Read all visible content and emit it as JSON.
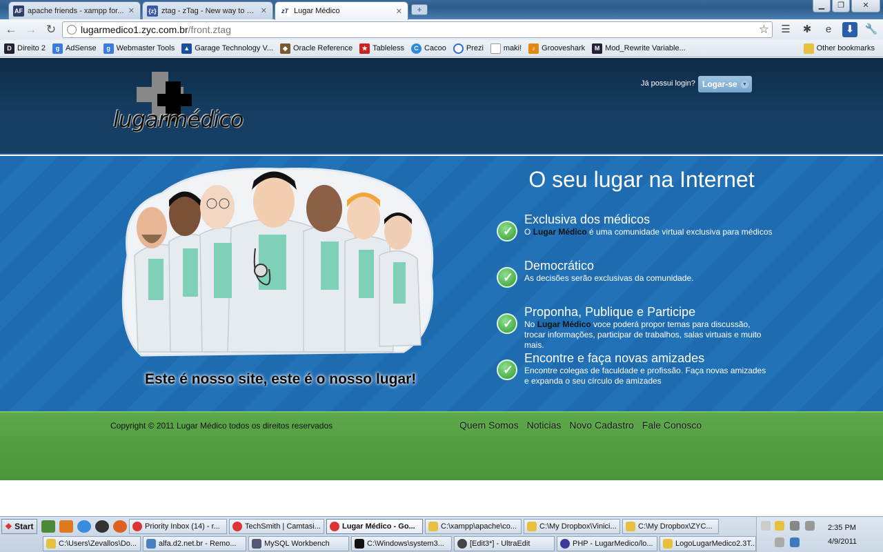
{
  "browser": {
    "tabs": [
      {
        "label": "apache friends - xampp for...",
        "icon": "AF",
        "icon_color": "#2a3d6a"
      },
      {
        "label": "ztag - zTag - New way to d...",
        "icon": "{z}",
        "icon_color": "#3a5aa5"
      },
      {
        "label": "Lugar Médico",
        "icon": "zT",
        "icon_color": "#0d3b70"
      }
    ],
    "url_host": "lugarmedico1.zyc.com.br",
    "url_path": "/front.ztag",
    "bookmarks": [
      {
        "label": "Direito 2",
        "color": "#223"
      },
      {
        "label": "AdSense",
        "color": "#3a7be0"
      },
      {
        "label": "Webmaster Tools",
        "color": "#3a7be0"
      },
      {
        "label": "Garage Technology V...",
        "color": "#1a4f9e"
      },
      {
        "label": "Oracle Reference",
        "color": "#7a5a30"
      },
      {
        "label": "Tableless",
        "color": "#cc2222"
      },
      {
        "label": "Cacoo",
        "color": "#2a8ae0"
      },
      {
        "label": "Prezi",
        "color": "#2a6bd0"
      },
      {
        "label": "maki!",
        "color": "#999"
      },
      {
        "label": "Grooveshark",
        "color": "#e08a10"
      },
      {
        "label": "Mod_Rewrite Variable...",
        "color": "#223"
      }
    ],
    "other_bookmarks": "Other bookmarks"
  },
  "site": {
    "logo_text": "lugarmédico",
    "login_question": "Já possui login?",
    "login_button": "Logar-se",
    "slogan": "Este é nosso site, este é o nosso lugar!",
    "hero_title": "O seu lugar na Internet",
    "features": [
      {
        "title": "Exclusiva dos médicos",
        "pre": "O ",
        "bold": "Lugar Médico",
        "post": " é uma comunidade virtual exclusiva para médicos"
      },
      {
        "title": "Democrático",
        "pre": "As decisões serão exclusivas da comunidade.",
        "bold": "",
        "post": ""
      },
      {
        "title": "Proponha, Publique e Participe",
        "pre": "No ",
        "bold": "Lugar Médico",
        "post": " voce poderá propor temas para discussão, trocar informações, participar de trabalhos, salas virtuais e muito mais."
      },
      {
        "title": "Encontre e faça novas amizades",
        "pre": "Encontre colegas de faculdade e profissão. Faça novas amizades e expanda o seu círculo de amizades",
        "bold": "",
        "post": ""
      }
    ],
    "copyright": "Copyright © 2011 Lugar Médico todos os direitos reservados",
    "footer_links": [
      "Quem Somos",
      "Noticias",
      "Novo Cadastro",
      "Fale Conosco"
    ]
  },
  "taskbar": {
    "start_label": "Start",
    "row1": [
      {
        "label": "Priority Inbox (14) - r...",
        "color": "#d33"
      },
      {
        "label": "TechSmith | Camtasi...",
        "color": "#d33"
      },
      {
        "label": "Lugar Médico - Go...",
        "color": "#d33",
        "active": true
      },
      {
        "label": "C:\\xampp\\apache\\co...",
        "color": "#e8c040"
      },
      {
        "label": "C:\\My Dropbox\\Vinici...",
        "color": "#e8c040"
      },
      {
        "label": "C:\\My Dropbox\\ZYC...",
        "color": "#e8c040"
      }
    ],
    "row2": [
      {
        "label": "C:\\Users\\Zevallos\\Do...",
        "color": "#e8c040"
      },
      {
        "label": "alfa.d2.net.br - Remo...",
        "color": "#4a7fc0"
      },
      {
        "label": "MySQL Workbench",
        "color": "#557"
      },
      {
        "label": "C:\\Windows\\system3...",
        "color": "#111"
      },
      {
        "label": "[Edit3*] - UltraEdit",
        "color": "#444"
      },
      {
        "label": "PHP - LugarMedico/lo...",
        "color": "#3a3a9a"
      },
      {
        "label": "LogoLugarMedico2.3T...",
        "color": "#e8c040"
      }
    ],
    "time": "2:35 PM",
    "date": "4/9/2011"
  }
}
